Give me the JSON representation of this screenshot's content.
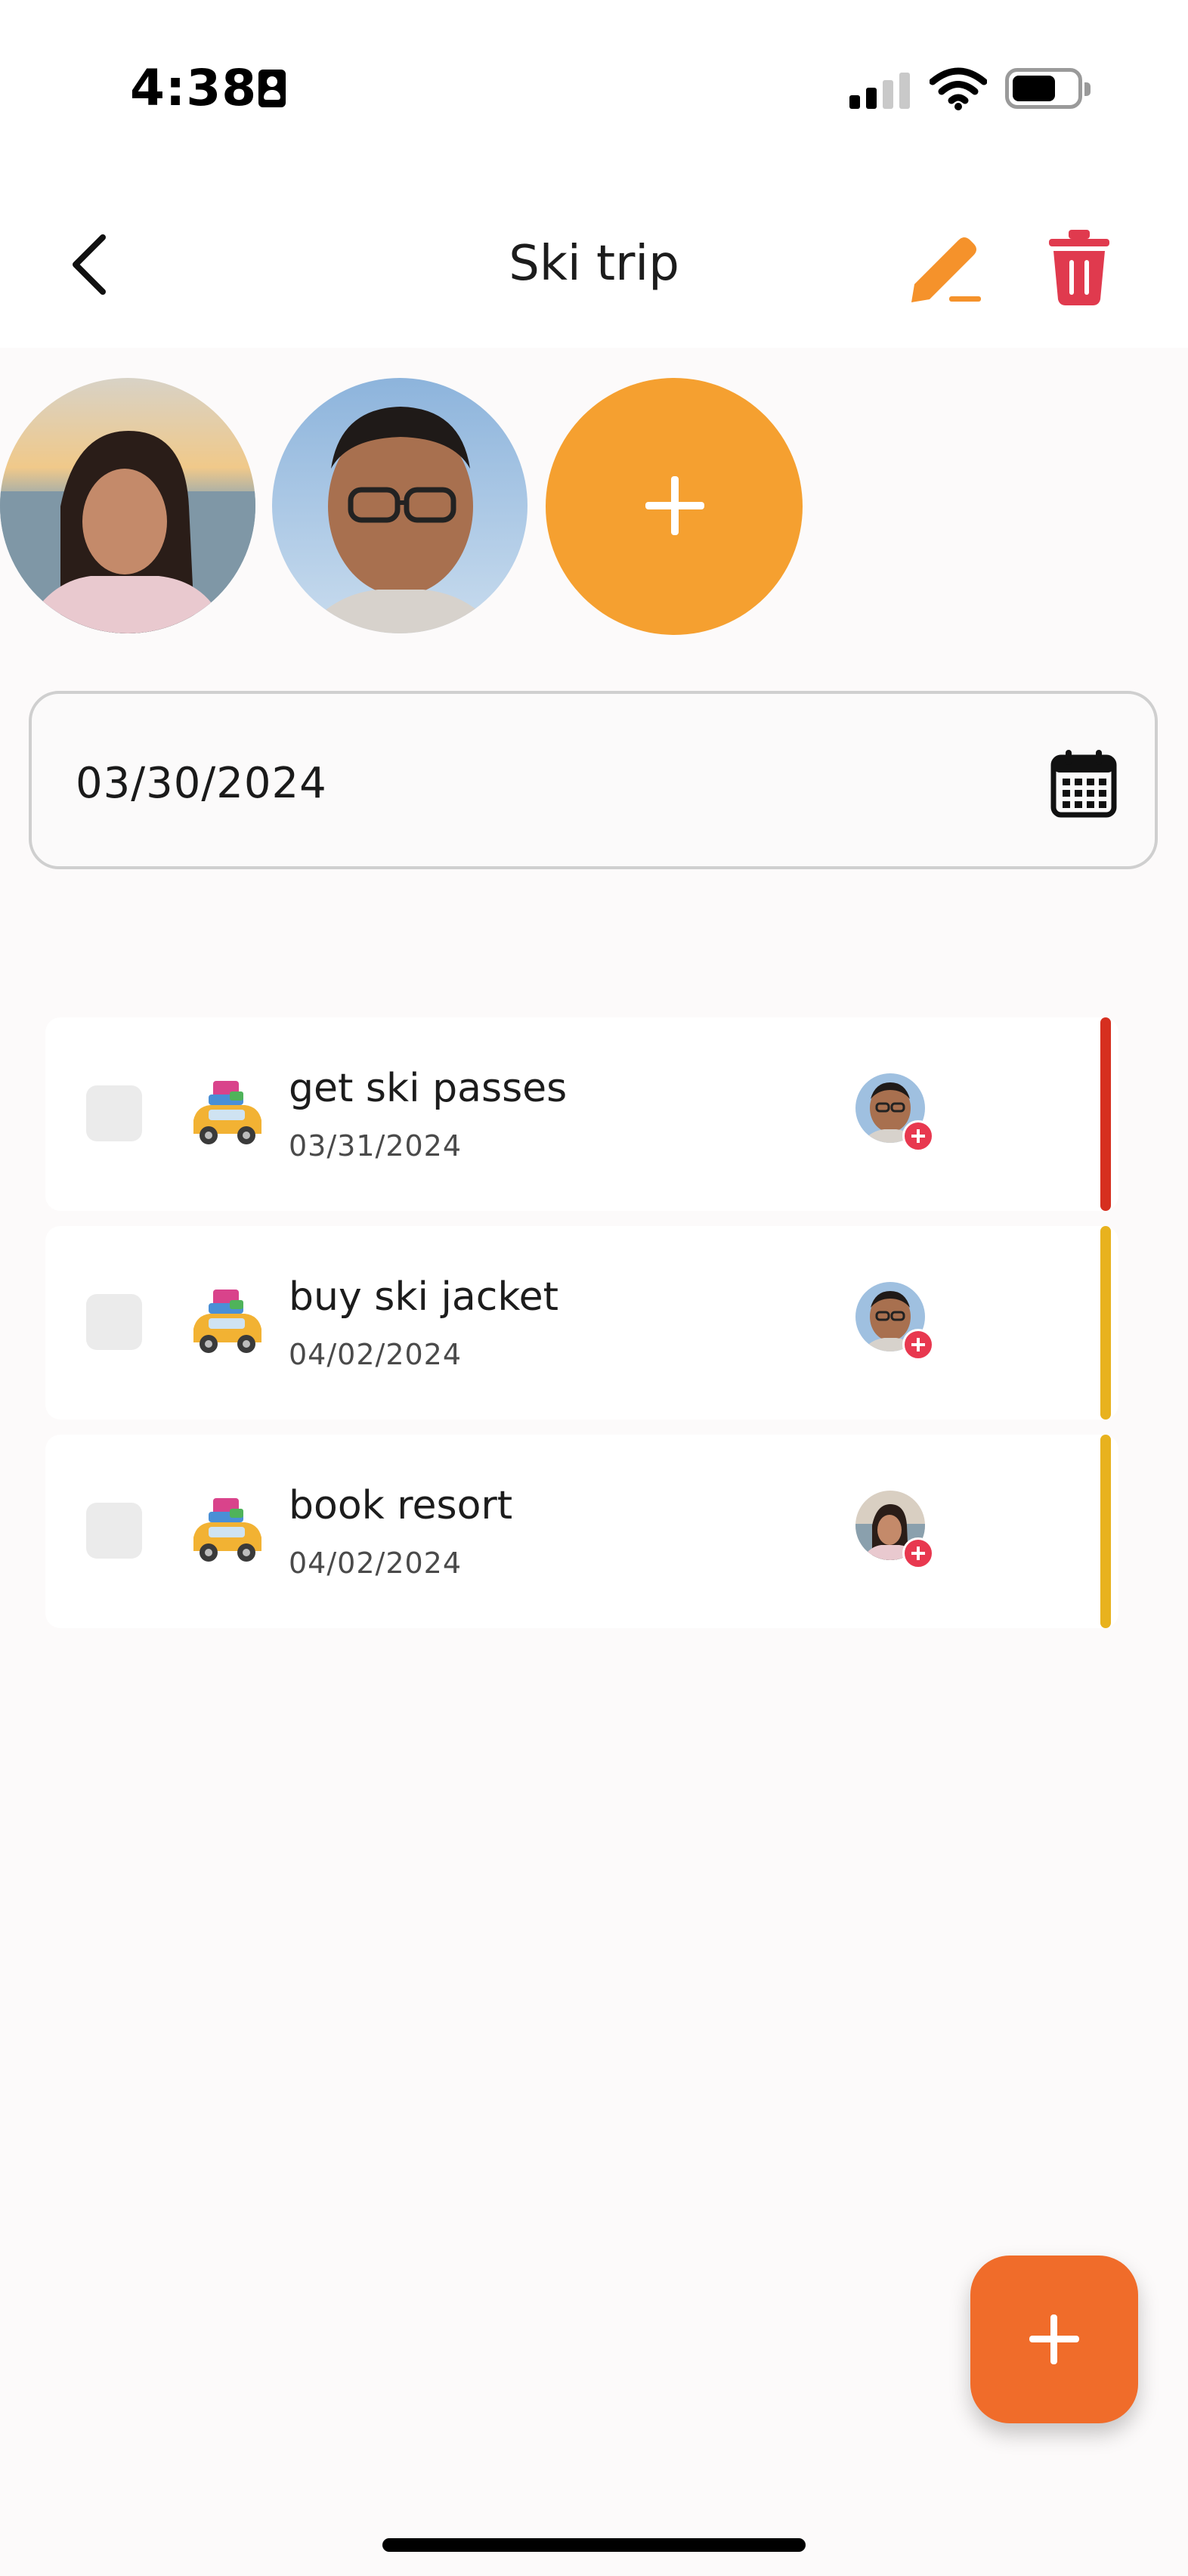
{
  "status_bar": {
    "time": "4:38",
    "icons": [
      "contact-card-icon",
      "cellular-signal-icon",
      "wifi-icon",
      "battery-icon"
    ]
  },
  "nav": {
    "title": "Ski trip",
    "icons": {
      "back": "chevron-left-icon",
      "edit": "pencil-icon",
      "delete": "trash-icon"
    },
    "colors": {
      "edit": "#f5922b",
      "delete": "#e03a4e"
    }
  },
  "members": {
    "avatars": [
      {
        "description_icon": "member-avatar-woman"
      },
      {
        "description_icon": "member-avatar-man"
      }
    ],
    "add_icon": "plus-icon",
    "accent": "#f5a030"
  },
  "date_field": {
    "value": "03/30/2024",
    "icon": "calendar-icon"
  },
  "tasks": [
    {
      "title": "get ski passes",
      "date": "03/31/2024",
      "category_icon": "car-with-luggage-icon",
      "assignee": "man",
      "priority_color": "#d62f1f",
      "checked": false
    },
    {
      "title": "buy ski jacket",
      "date": "04/02/2024",
      "category_icon": "car-with-luggage-icon",
      "assignee": "man",
      "priority_color": "#e8b21e",
      "checked": false
    },
    {
      "title": "book resort",
      "date": "04/02/2024",
      "category_icon": "car-with-luggage-icon",
      "assignee": "woman",
      "priority_color": "#e8b21e",
      "checked": false
    }
  ],
  "fab": {
    "icon": "plus-icon",
    "color": "#f06c2a"
  }
}
